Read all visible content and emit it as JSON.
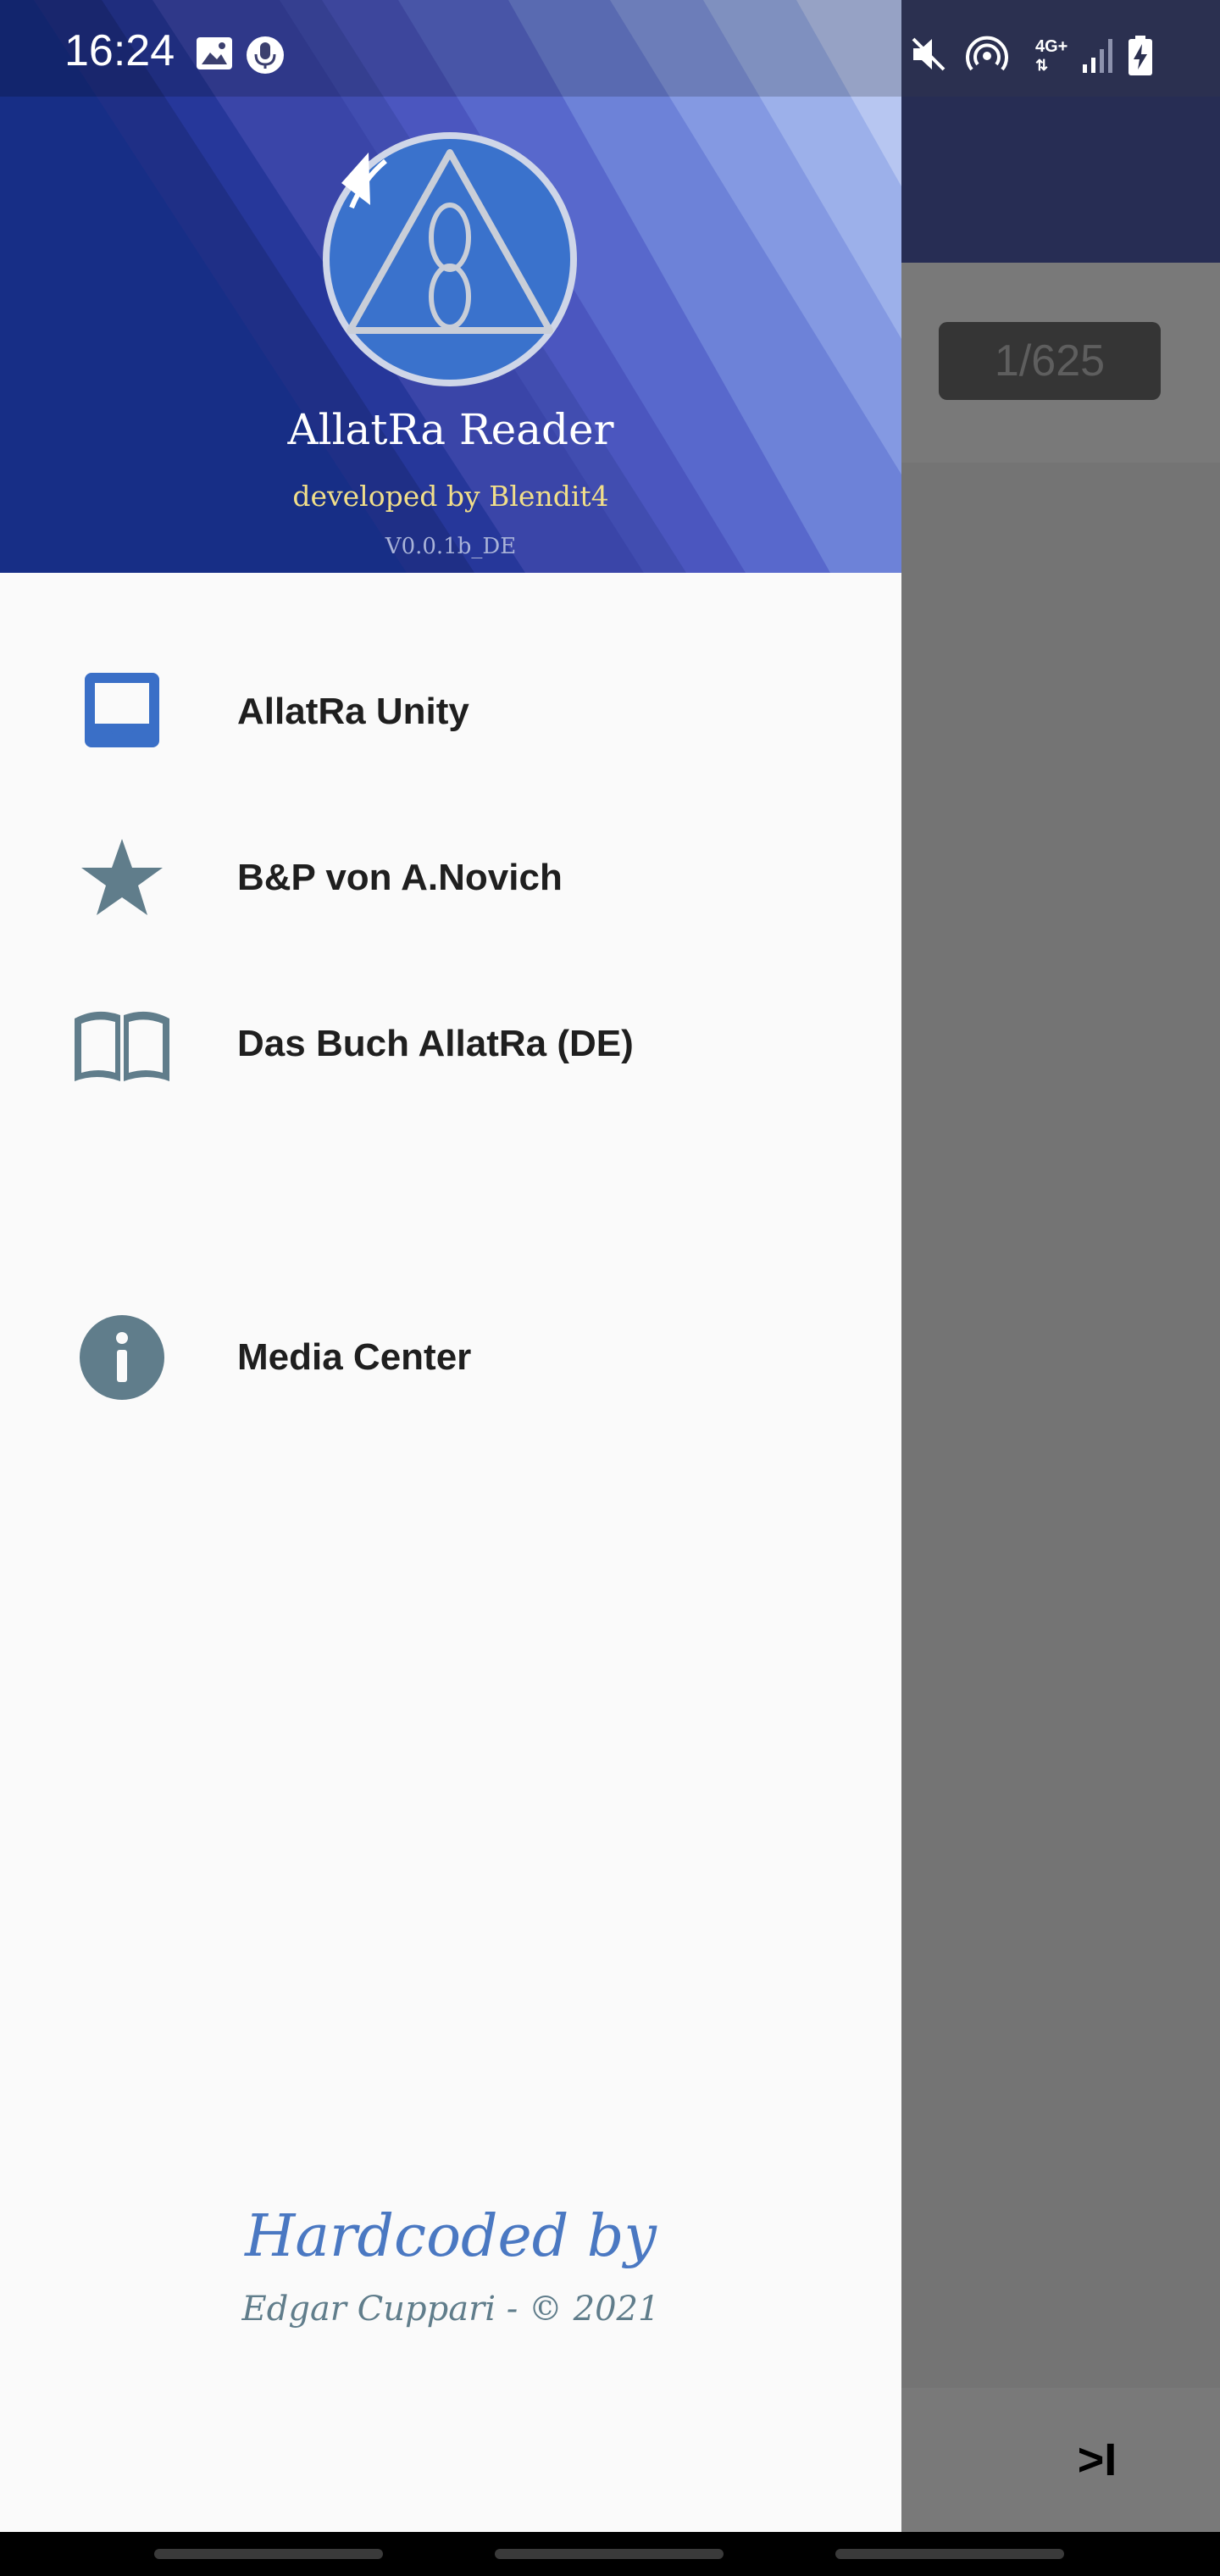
{
  "status_bar": {
    "time": "16:24",
    "left_icons": [
      "image-icon",
      "microphone-icon"
    ],
    "right_icons": [
      "mute-icon",
      "hotspot-icon",
      "network-4g-plus-icon",
      "signal-icon",
      "battery-charging-icon"
    ],
    "network_label": "4G+"
  },
  "background_app": {
    "page_counter": "1/625",
    "next_end_icon": "skip-to-end-icon",
    "next_end_label": ">I"
  },
  "drawer": {
    "header": {
      "logo_icon": "allatra-logo-icon",
      "title": "AllatRa Reader",
      "subtitle": "developed by Blendit4",
      "version": "V0.0.1b_DE"
    },
    "items": [
      {
        "label": "AllatRa Unity",
        "icon": "inbox-icon",
        "color": "#3a6fc7"
      },
      {
        "label": "B&P von A.Novich",
        "icon": "star-icon",
        "color": "#607d8b"
      },
      {
        "label": "Das Buch AllatRa (DE)",
        "icon": "book-open-icon",
        "color": "#607d8b"
      },
      {
        "label": "Media Center",
        "icon": "info-icon",
        "color": "#607d8b"
      }
    ],
    "footer": {
      "title": "Hardcoded by",
      "credit": "Edgar Cuppari - © 2021"
    }
  },
  "colors": {
    "drawer_background": "#fafafa",
    "accent_blue": "#4a78c2",
    "icon_grey": "#607d8b",
    "subtitle_gold": "#f1de8a"
  }
}
